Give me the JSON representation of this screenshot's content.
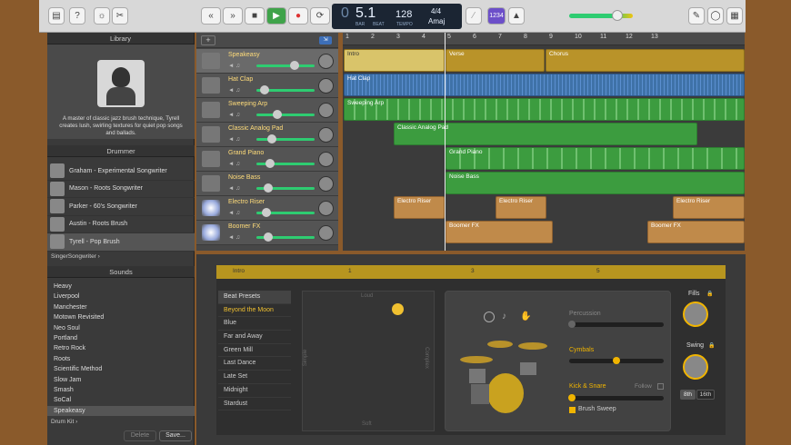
{
  "toolbar": {
    "transport": {
      "rewind": "«",
      "forward": "»",
      "stop": "■",
      "play": "▶",
      "record": "●",
      "cycle": "⟳"
    },
    "lcd": {
      "bar": "5.1",
      "bar_label": "BAR",
      "beat_label": "BEAT",
      "tempo": "128",
      "tempo_label": "TEMPO",
      "signature": "4/4",
      "key": "Amaj"
    },
    "count_in": "1234"
  },
  "library": {
    "title": "Library",
    "description": "A master of classic jazz brush technique, Tyrell creates lush, swirling textures for quiet pop songs and ballads.",
    "drummer_header": "Drummer",
    "drummers": [
      "Graham - Experimental Songwriter",
      "Mason - Roots Songwriter",
      "Parker - 60's Songwriter",
      "Austin - Roots Brush",
      "Tyrell - Pop Brush"
    ],
    "genre": "SingerSongwriter",
    "sounds_header": "Sounds",
    "sounds": [
      "Heavy",
      "Liverpool",
      "Manchester",
      "Motown Revisited",
      "Neo Soul",
      "Portland",
      "Retro Rock",
      "Roots",
      "Scientific Method",
      "Slow Jam",
      "Smash",
      "SoCal",
      "Speakeasy"
    ],
    "selected_sound": "Speakeasy",
    "kit_label": "Drum Kit",
    "delete": "Delete",
    "save": "Save..."
  },
  "tracks": [
    {
      "name": "Speakeasy"
    },
    {
      "name": "Hat Clap"
    },
    {
      "name": "Sweeping Arp"
    },
    {
      "name": "Classic Analog Pad"
    },
    {
      "name": "Grand Piano"
    },
    {
      "name": "Noise Bass"
    },
    {
      "name": "Electro Riser"
    },
    {
      "name": "Boomer FX"
    }
  ],
  "ruler": [
    "1",
    "2",
    "3",
    "4",
    "5",
    "6",
    "7",
    "8",
    "9",
    "10",
    "11",
    "12",
    "13"
  ],
  "arrange": {
    "sections": [
      "Intro",
      "Verse",
      "Chorus"
    ],
    "regions": {
      "hat_clap": "Hat Clap",
      "sweeping_arp": "Sweeping Arp",
      "classic_pad": "Classic Analog Pad",
      "grand_piano": "Grand Piano",
      "noise_bass": "Noise Bass",
      "electro_riser_1": "Electro Riser",
      "electro_riser_2": "Electro Riser",
      "electro_riser_3": "Electro Riser",
      "boomer_1": "Boomer FX",
      "boomer_2": "Boomer FX"
    }
  },
  "editor": {
    "region_label": "Intro",
    "ruler": [
      "1",
      "3",
      "5"
    ],
    "presets_header": "Beat Presets",
    "presets": [
      "Beyond the Moon",
      "Blue",
      "Far and Away",
      "Green Mill",
      "Last Dance",
      "Late Set",
      "Midnight",
      "Stardust"
    ],
    "selected_preset": "Beyond the Moon",
    "xy": {
      "loud": "Loud",
      "soft": "Soft",
      "simple": "Simple",
      "complex": "Complex"
    },
    "percussion": "Percussion",
    "cymbals": "Cymbals",
    "kick_snare": "Kick & Snare",
    "follow": "Follow",
    "brush_sweep": "Brush Sweep",
    "fills": "Fills",
    "swing": "Swing",
    "swing_8th": "8th",
    "swing_16th": "16th"
  }
}
